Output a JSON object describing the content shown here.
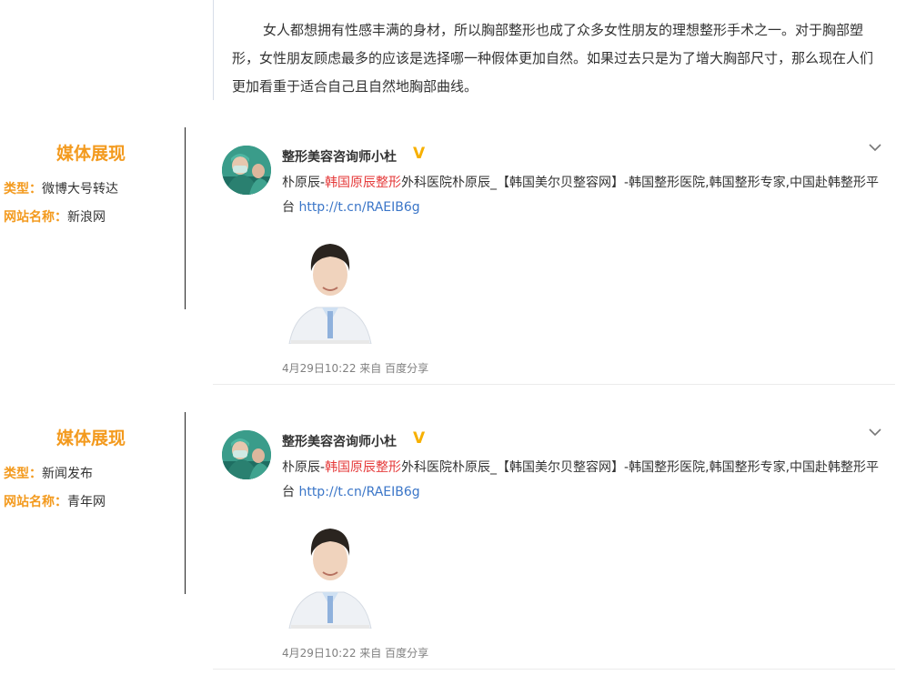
{
  "intro": {
    "text": "女人都想拥有性感丰满的身材，所以胸部整形也成了众多女性朋友的理想整形手术之一。对于胸部塑形，女性朋友顾虑最多的应该是选择哪一种假体更加自然。如果过去只是为了增大胸部尺寸，那么现在人们更加看重于适合自己且自然地胸部曲线。"
  },
  "sections": [
    {
      "heading": "媒体展现",
      "type_label": "类型：",
      "type_value": "微博大号转达",
      "site_label": "网站名称：",
      "site_value": "新浪网",
      "post": {
        "username": "整形美容咨询师小杜",
        "verified_badge": "V",
        "text_part1": "朴原辰-",
        "text_red": "韩国原辰整形",
        "text_part2": "外科医院朴原辰_【韩国美尔贝整容网】-韩国整形医院,韩国整形专家,中国赴韩整形平台 ",
        "link": "http://t.cn/RAEIB6g",
        "meta": "4月29日10:22 来自 百度分享"
      }
    },
    {
      "heading": "媒体展现",
      "type_label": "类型：",
      "type_value": "新闻发布",
      "site_label": "网站名称：",
      "site_value": "青年网",
      "post": {
        "username": "整形美容咨询师小杜",
        "verified_badge": "V",
        "text_part1": "朴原辰-",
        "text_red": "韩国原辰整形",
        "text_part2": "外科医院朴原辰_【韩国美尔贝整容网】-韩国整形医院,韩国整形专家,中国赴韩整形平台 ",
        "link": "http://t.cn/RAEIB6g",
        "meta": "4月29日10:22 来自 百度分享"
      }
    }
  ]
}
